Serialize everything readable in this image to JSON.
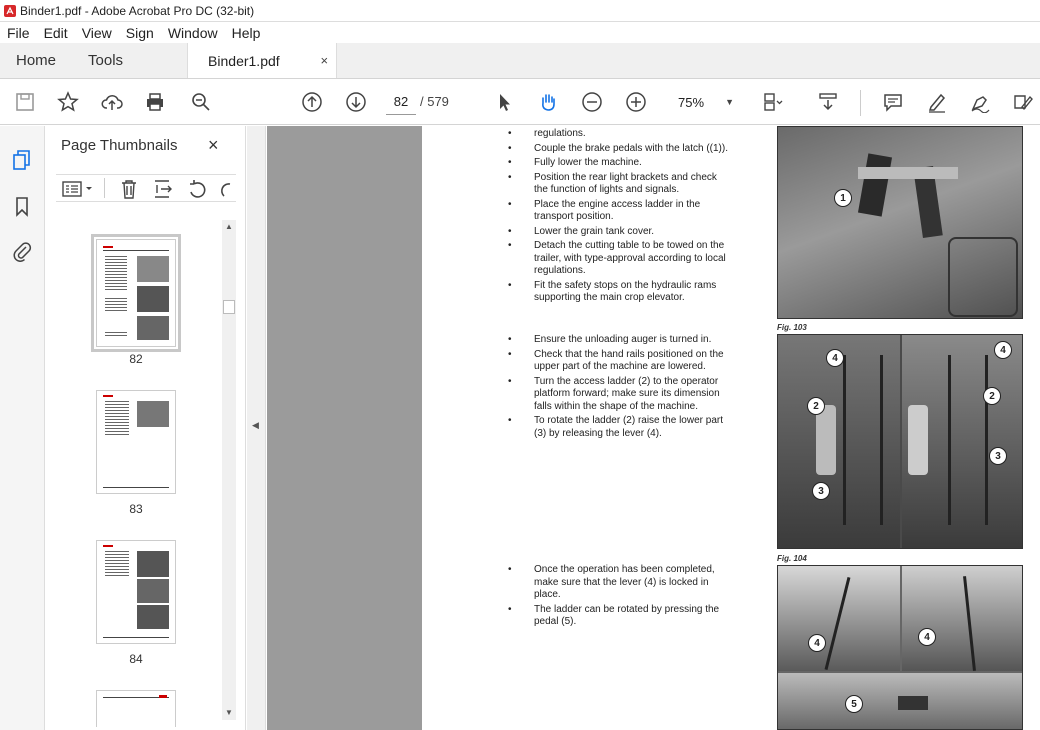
{
  "window": {
    "title": "Binder1.pdf - Adobe Acrobat Pro DC (32-bit)"
  },
  "menu": [
    "File",
    "Edit",
    "View",
    "Sign",
    "Window",
    "Help"
  ],
  "tabs": {
    "home": "Home",
    "tools": "Tools",
    "document": "Binder1.pdf",
    "close": "×"
  },
  "toolbar": {
    "page_current": "82",
    "page_total": "/ 579",
    "zoom": "75%"
  },
  "panel": {
    "title": "Page Thumbnails",
    "close": "×",
    "thumbnails": [
      {
        "label": "82",
        "selected": true
      },
      {
        "label": "83",
        "selected": false
      },
      {
        "label": "84",
        "selected": false
      }
    ]
  },
  "document": {
    "section1": [
      "regulations.",
      "Couple the brake pedals with the latch ((1)).",
      "Fully lower the machine.",
      "Position the rear light brackets and check the function of lights and signals.",
      "Place the engine access ladder in the transport position.",
      "Lower the grain tank cover.",
      "Detach the cutting table to be towed on the trailer, with type-approval according to local regulations.",
      "Fit the safety stops on the hydraulic rams supporting the main crop elevator."
    ],
    "section2": [
      "Ensure the unloading auger is turned in.",
      "Check that the hand rails positioned on the upper part of the machine are lowered.",
      "Turn the access ladder (2) to the operator platform forward; make sure its dimension falls within the shape of the machine.",
      "To rotate the ladder (2) raise the lower part (3) by releasing the lever (4)."
    ],
    "section3": [
      "Once the operation has been completed, make sure that the lever (4) is locked in place.",
      "The ladder can be rotated by pressing the pedal (5)."
    ],
    "fig103": "Fig. 103",
    "fig104": "Fig. 104",
    "callouts": {
      "c1": "1",
      "c2": "2",
      "c3": "3",
      "c4": "4",
      "c5": "5"
    }
  }
}
